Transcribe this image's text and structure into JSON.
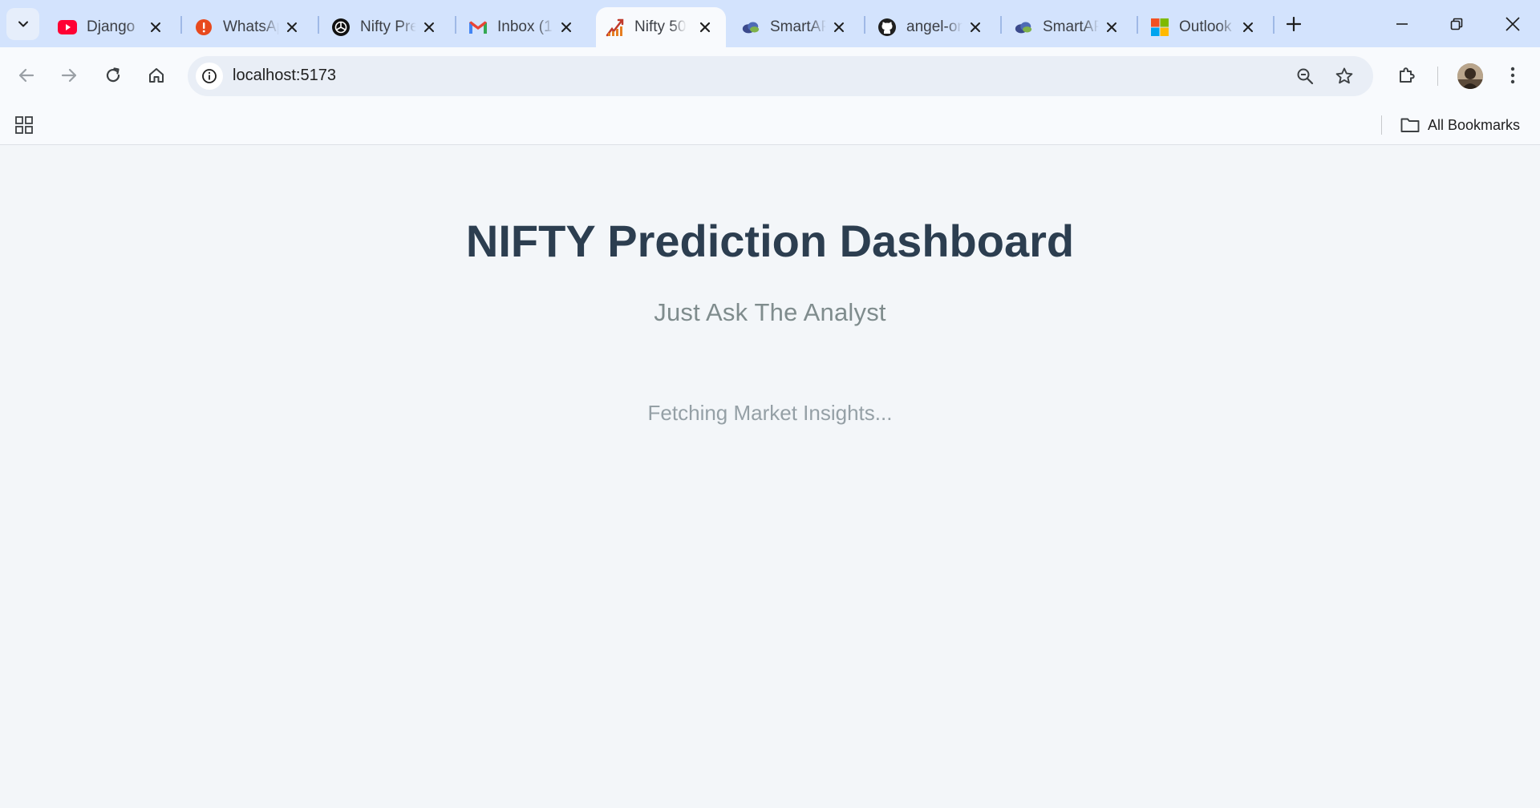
{
  "browser": {
    "tabs": [
      {
        "title": "Django",
        "icon": "youtube-icon",
        "active": false
      },
      {
        "title": "WhatsApp",
        "icon": "alert-icon",
        "active": false
      },
      {
        "title": "Nifty Prediction",
        "icon": "openai-icon",
        "active": false
      },
      {
        "title": "Inbox (1",
        "icon": "gmail-icon",
        "active": false
      },
      {
        "title": "Nifty 50",
        "icon": "nifty-icon",
        "active": true
      },
      {
        "title": "SmartAPI",
        "icon": "smartapi-icon",
        "active": false
      },
      {
        "title": "angel-one",
        "icon": "github-icon",
        "active": false
      },
      {
        "title": "SmartAPI",
        "icon": "smartapi-icon",
        "active": false
      },
      {
        "title": "Outlook",
        "icon": "microsoft-icon",
        "active": false
      }
    ],
    "address": "localhost:5173",
    "bookmarks_all_label": "All Bookmarks",
    "colors": {
      "tabstrip": "#d3e3fd",
      "toolbar": "#f8fafd",
      "omnibox": "#e9eef6"
    }
  },
  "page": {
    "title": "NIFTY Prediction Dashboard",
    "subtitle": "Just Ask The Analyst",
    "loading_text": "Fetching Market Insights...",
    "colors": {
      "background": "#f3f6f9",
      "title": "#2c3e50",
      "subtitle": "#7f8c8d",
      "loading": "#95a0a6"
    }
  }
}
